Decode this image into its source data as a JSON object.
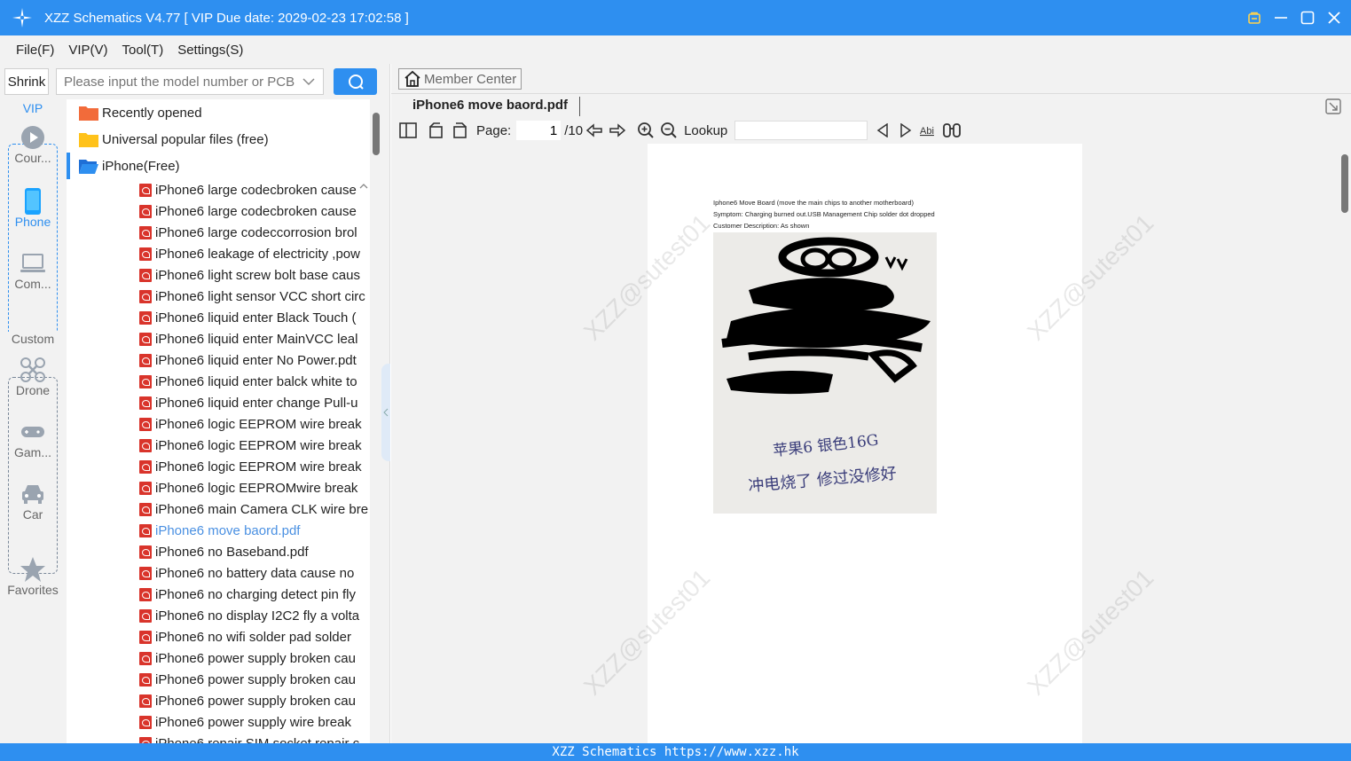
{
  "window": {
    "title": "XZZ Schematics V4.77 [ VIP Due date: 2029-02-23 17:02:58 ]",
    "accent": "#2e8ff0"
  },
  "menu": [
    "File(F)",
    "VIP(V)",
    "Tool(T)",
    "Settings(S)"
  ],
  "left": {
    "shrink_label": "Shrink",
    "search_placeholder": "Please input the model number or PCB",
    "categories": {
      "vip_label": "VIP",
      "custom_label": "Custom",
      "items": [
        "Cour...",
        "Phone",
        "Com...",
        "Drone",
        "Gam...",
        "Car",
        "Favorites"
      ]
    },
    "folders": [
      "Recently opened",
      "Universal popular files (free)",
      "iPhone(Free)"
    ],
    "files": [
      "iPhone6 large codecbroken cause",
      "iPhone6 large codecbroken cause",
      "iPhone6 large codeccorrosion brol",
      "iPhone6 leakage of electricity ,pow",
      "iPhone6 light screw bolt base caus",
      "iPhone6 light sensor VCC short circ",
      "iPhone6 liquid enter Black Touch (",
      "iPhone6 liquid enter MainVCC leal",
      "iPhone6 liquid enter No Power.pdt",
      "iPhone6 liquid enter balck white to",
      "iPhone6 liquid enter change Pull-u",
      "iPhone6 logic EEPROM wire break",
      "iPhone6 logic EEPROM wire break",
      "iPhone6 logic EEPROM wire break",
      "iPhone6 logic EEPROMwire break",
      "iPhone6 main Camera CLK wire bre",
      "iPhone6 move baord.pdf",
      "iPhone6 no Baseband.pdf",
      "iPhone6 no battery data cause no",
      "iPhone6 no charging detect pin fly",
      "iPhone6 no display I2C2 fly a volta",
      "iPhone6 no wifi solder pad solder",
      "iPhone6 power supply broken cau",
      "iPhone6 power supply broken cau",
      "iPhone6 power supply broken cau",
      "iPhone6 power supply wire break",
      "iPhone6 repair SIM socket repair c"
    ]
  },
  "right": {
    "member_center": "Member Center",
    "doc_tab": "iPhone6 move baord.pdf",
    "page_label": "Page:",
    "page_current": "1",
    "page_total": "/10",
    "lookup_label": "Lookup",
    "doc_lines": [
      "Iphone6 Move Board (move the main chips to another motherboard)",
      "Symptom: Charging burned out.USB Management Chip solder dot dropped",
      "Customer Description: As shown"
    ],
    "photo_caption_1": "苹果6 银色16G",
    "photo_caption_2": "冲电烧了 修过没修好",
    "watermark": "XZZ@sutest01"
  },
  "status": "XZZ Schematics https://www.xzz.hk"
}
